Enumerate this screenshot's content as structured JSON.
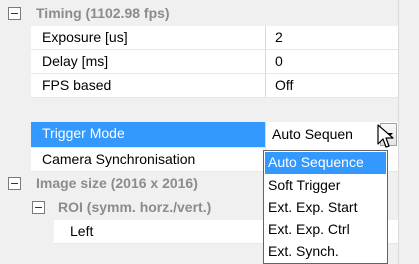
{
  "categories": {
    "timing": "Timing (1102.98 fps)",
    "image_size": "Image size (2016 x 2016)",
    "roi": "ROI (symm. horz./vert.)"
  },
  "properties": [
    {
      "name": "Exposure [us]",
      "value": "2"
    },
    {
      "name": "Delay [ms]",
      "value": "0"
    },
    {
      "name": "FPS based",
      "value": "Off"
    },
    {
      "name": "Trigger Mode",
      "value": "Auto Sequen"
    },
    {
      "name": "Camera Synchronisation",
      "value": ""
    },
    {
      "name": "Left",
      "value": ""
    }
  ],
  "dropdown": {
    "options": [
      "Auto Sequence",
      "Soft Trigger",
      "Ext. Exp. Start",
      "Ext. Exp. Ctrl",
      "Ext. Synch."
    ],
    "selected": "Auto Sequence"
  },
  "colors": {
    "selection": "#3399ff",
    "category_text": "#8c8c8c",
    "background": "#f0f0f0"
  },
  "icons": [
    "collapse-minus-icon",
    "dropdown-arrow-icon",
    "mouse-pointer-icon"
  ]
}
